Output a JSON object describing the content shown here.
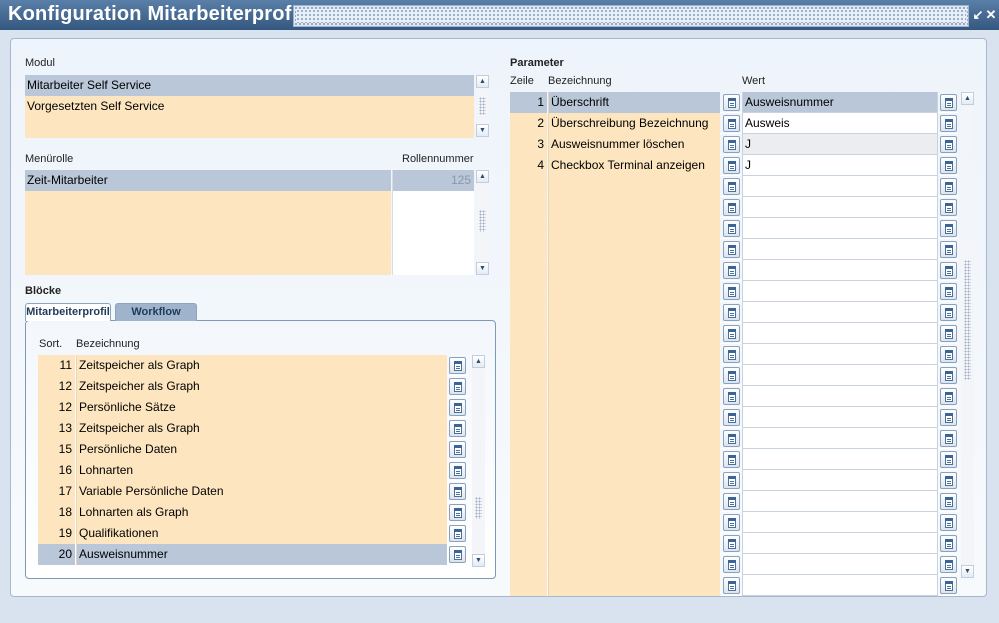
{
  "window": {
    "title": "Konfiguration Mitarbeiterprofil"
  },
  "modul": {
    "label": "Modul",
    "rows": [
      "Mitarbeiter Self Service",
      "Vorgesetzten Self Service",
      ""
    ]
  },
  "menuerolle": {
    "label": "Menürolle",
    "number_label": "Rollennummer",
    "rows": [
      {
        "name": "Zeit-Mitarbeiter",
        "number": "125"
      },
      {
        "name": "",
        "number": ""
      },
      {
        "name": "",
        "number": ""
      },
      {
        "name": "",
        "number": ""
      },
      {
        "name": "",
        "number": ""
      }
    ]
  },
  "bloecke": {
    "label": "Blöcke",
    "tabs": [
      "Mitarbeiterprofil",
      "Workflow"
    ],
    "col_sort": "Sort.",
    "col_name": "Bezeichnung",
    "rows": [
      {
        "sort": "11",
        "name": "Zeitspeicher als Graph"
      },
      {
        "sort": "12",
        "name": "Zeitspeicher als Graph"
      },
      {
        "sort": "12",
        "name": "Persönliche Sätze"
      },
      {
        "sort": "13",
        "name": "Zeitspeicher als Graph"
      },
      {
        "sort": "15",
        "name": "Persönliche Daten"
      },
      {
        "sort": "16",
        "name": "Lohnarten"
      },
      {
        "sort": "17",
        "name": "Variable Persönliche Daten"
      },
      {
        "sort": "18",
        "name": "Lohnarten als Graph"
      },
      {
        "sort": "19",
        "name": "Qualifikationen"
      },
      {
        "sort": "20",
        "name": "Ausweisnummer"
      }
    ]
  },
  "parameter": {
    "label": "Parameter",
    "col_line": "Zeile",
    "col_name": "Bezeichnung",
    "col_value": "Wert",
    "rows": [
      {
        "line": "1",
        "name": "Überschrift",
        "value": "Ausweisnummer"
      },
      {
        "line": "2",
        "name": "Überschreibung Bezeichnung",
        "value": "Ausweis"
      },
      {
        "line": "3",
        "name": "Ausweisnummer löschen",
        "value": "J"
      },
      {
        "line": "4",
        "name": "Checkbox Terminal anzeigen",
        "value": "J"
      },
      {
        "line": "",
        "name": "",
        "value": ""
      },
      {
        "line": "",
        "name": "",
        "value": ""
      },
      {
        "line": "",
        "name": "",
        "value": ""
      },
      {
        "line": "",
        "name": "",
        "value": ""
      },
      {
        "line": "",
        "name": "",
        "value": ""
      },
      {
        "line": "",
        "name": "",
        "value": ""
      },
      {
        "line": "",
        "name": "",
        "value": ""
      },
      {
        "line": "",
        "name": "",
        "value": ""
      },
      {
        "line": "",
        "name": "",
        "value": ""
      },
      {
        "line": "",
        "name": "",
        "value": ""
      },
      {
        "line": "",
        "name": "",
        "value": ""
      },
      {
        "line": "",
        "name": "",
        "value": ""
      },
      {
        "line": "",
        "name": "",
        "value": ""
      },
      {
        "line": "",
        "name": "",
        "value": ""
      },
      {
        "line": "",
        "name": "",
        "value": ""
      },
      {
        "line": "",
        "name": "",
        "value": ""
      },
      {
        "line": "",
        "name": "",
        "value": ""
      },
      {
        "line": "",
        "name": "",
        "value": ""
      },
      {
        "line": "",
        "name": "",
        "value": ""
      },
      {
        "line": "",
        "name": "",
        "value": ""
      }
    ]
  },
  "icons": {
    "minimize": "minimize-icon",
    "close": "close-icon",
    "list_of_values": "list-of-values-icon",
    "scroll_up": "scroll-up-arrow-icon",
    "scroll_down": "scroll-down-arrow-icon"
  },
  "colors": {
    "titlebar": "#34577f",
    "selected_row": "#b9c7d8",
    "editable_row": "#fde6bf",
    "readonly_row": "#ecedf0"
  }
}
